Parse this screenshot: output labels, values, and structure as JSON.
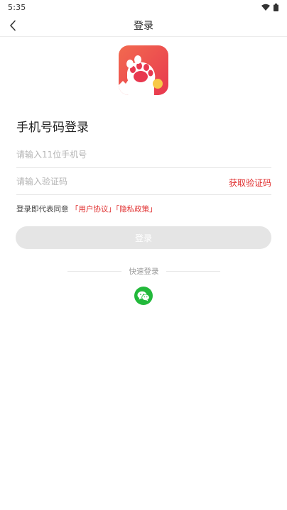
{
  "status_bar": {
    "time": "5:35",
    "icons": [
      "wifi-icon",
      "battery-icon"
    ]
  },
  "header": {
    "title": "登录",
    "back_icon": "chevron-left-icon"
  },
  "logo": {
    "icon": "paw-icon",
    "colors": {
      "gradient_top": "#f15a57",
      "gradient_bottom": "#ea3f55",
      "dot": "#f7c948"
    }
  },
  "login": {
    "heading": "手机号码登录",
    "phone_placeholder": "请输入11位手机号",
    "code_placeholder": "请输入验证码",
    "get_code_label": "获取验证码",
    "agreement_prefix": "登录即代表同意",
    "user_agreement": "「用户协议」",
    "privacy_policy": "「隐私政策」",
    "login_button": "登录"
  },
  "quick_login": {
    "label": "快速登录",
    "wechat_icon": "wechat-icon"
  },
  "colors": {
    "accent": "#e02d2d",
    "button_disabled": "#e5e5e5",
    "wechat": "#22b93b"
  }
}
